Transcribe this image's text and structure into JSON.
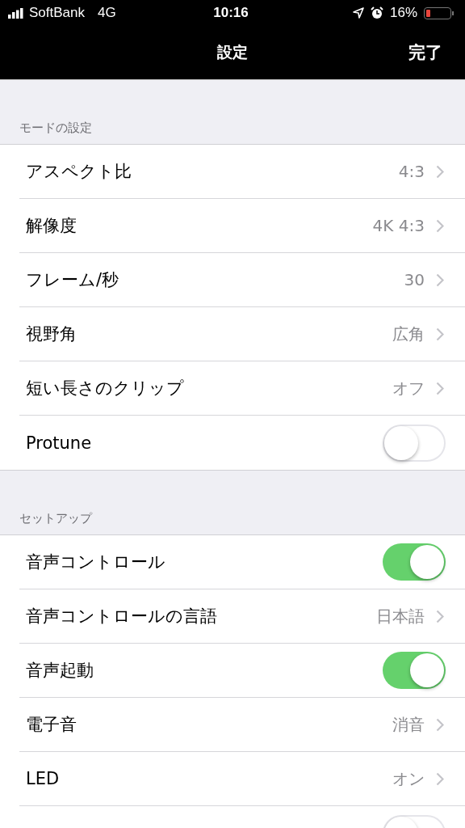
{
  "status_bar": {
    "carrier": "SoftBank",
    "network": "4G",
    "time": "10:16",
    "battery": "16%"
  },
  "nav_bar": {
    "title": "設定",
    "done": "完了"
  },
  "sections": [
    {
      "header": "モードの設定",
      "rows": [
        {
          "kind": "value",
          "label": "アスペクト比",
          "value": "4:3"
        },
        {
          "kind": "value",
          "label": "解像度",
          "value": "4K 4:3"
        },
        {
          "kind": "value",
          "label": "フレーム/秒",
          "value": "30"
        },
        {
          "kind": "value",
          "label": "視野角",
          "value": "広角"
        },
        {
          "kind": "value",
          "label": "短い長さのクリップ",
          "value": "オフ"
        },
        {
          "kind": "toggle",
          "label": "Protune",
          "on": false
        }
      ]
    },
    {
      "header": "セットアップ",
      "rows": [
        {
          "kind": "toggle",
          "label": "音声コントロール",
          "on": true
        },
        {
          "kind": "value",
          "label": "音声コントロールの言語",
          "value": "日本語"
        },
        {
          "kind": "toggle",
          "label": "音声起動",
          "on": true
        },
        {
          "kind": "value",
          "label": "電子音",
          "value": "消音"
        },
        {
          "kind": "value",
          "label": "LED",
          "value": "オン"
        },
        {
          "kind": "toggle",
          "on": false
        }
      ]
    }
  ]
}
